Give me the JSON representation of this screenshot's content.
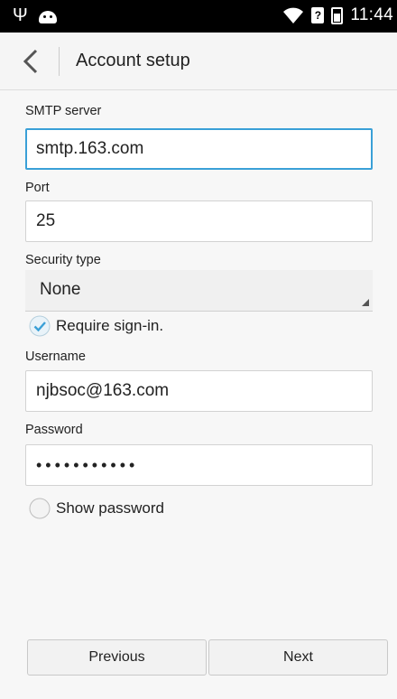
{
  "status_bar": {
    "left_icons": [
      "usb-icon",
      "android-icon"
    ],
    "right_icons": [
      "wifi-icon",
      "sim-icon",
      "battery-icon"
    ],
    "sim_glyph": "?",
    "time": "11:44"
  },
  "toolbar": {
    "title": "Account setup",
    "back_icon": "chevron-left-icon"
  },
  "form": {
    "smtp_server": {
      "label": "SMTP server",
      "value": "smtp.163.com"
    },
    "port": {
      "label": "Port",
      "value": "25"
    },
    "security_type": {
      "label": "Security type",
      "selected": "None"
    },
    "require_signin": {
      "label": "Require sign-in.",
      "checked": true
    },
    "username": {
      "label": "Username",
      "value": "njbsoc@163.com"
    },
    "password": {
      "label": "Password",
      "value": "•••••••••••"
    },
    "show_password": {
      "label": "Show password",
      "checked": false
    }
  },
  "buttons": {
    "previous": "Previous",
    "next": "Next"
  },
  "colors": {
    "accent": "#3aa0d7",
    "status_bar": "#000000",
    "background": "#f7f7f7"
  }
}
